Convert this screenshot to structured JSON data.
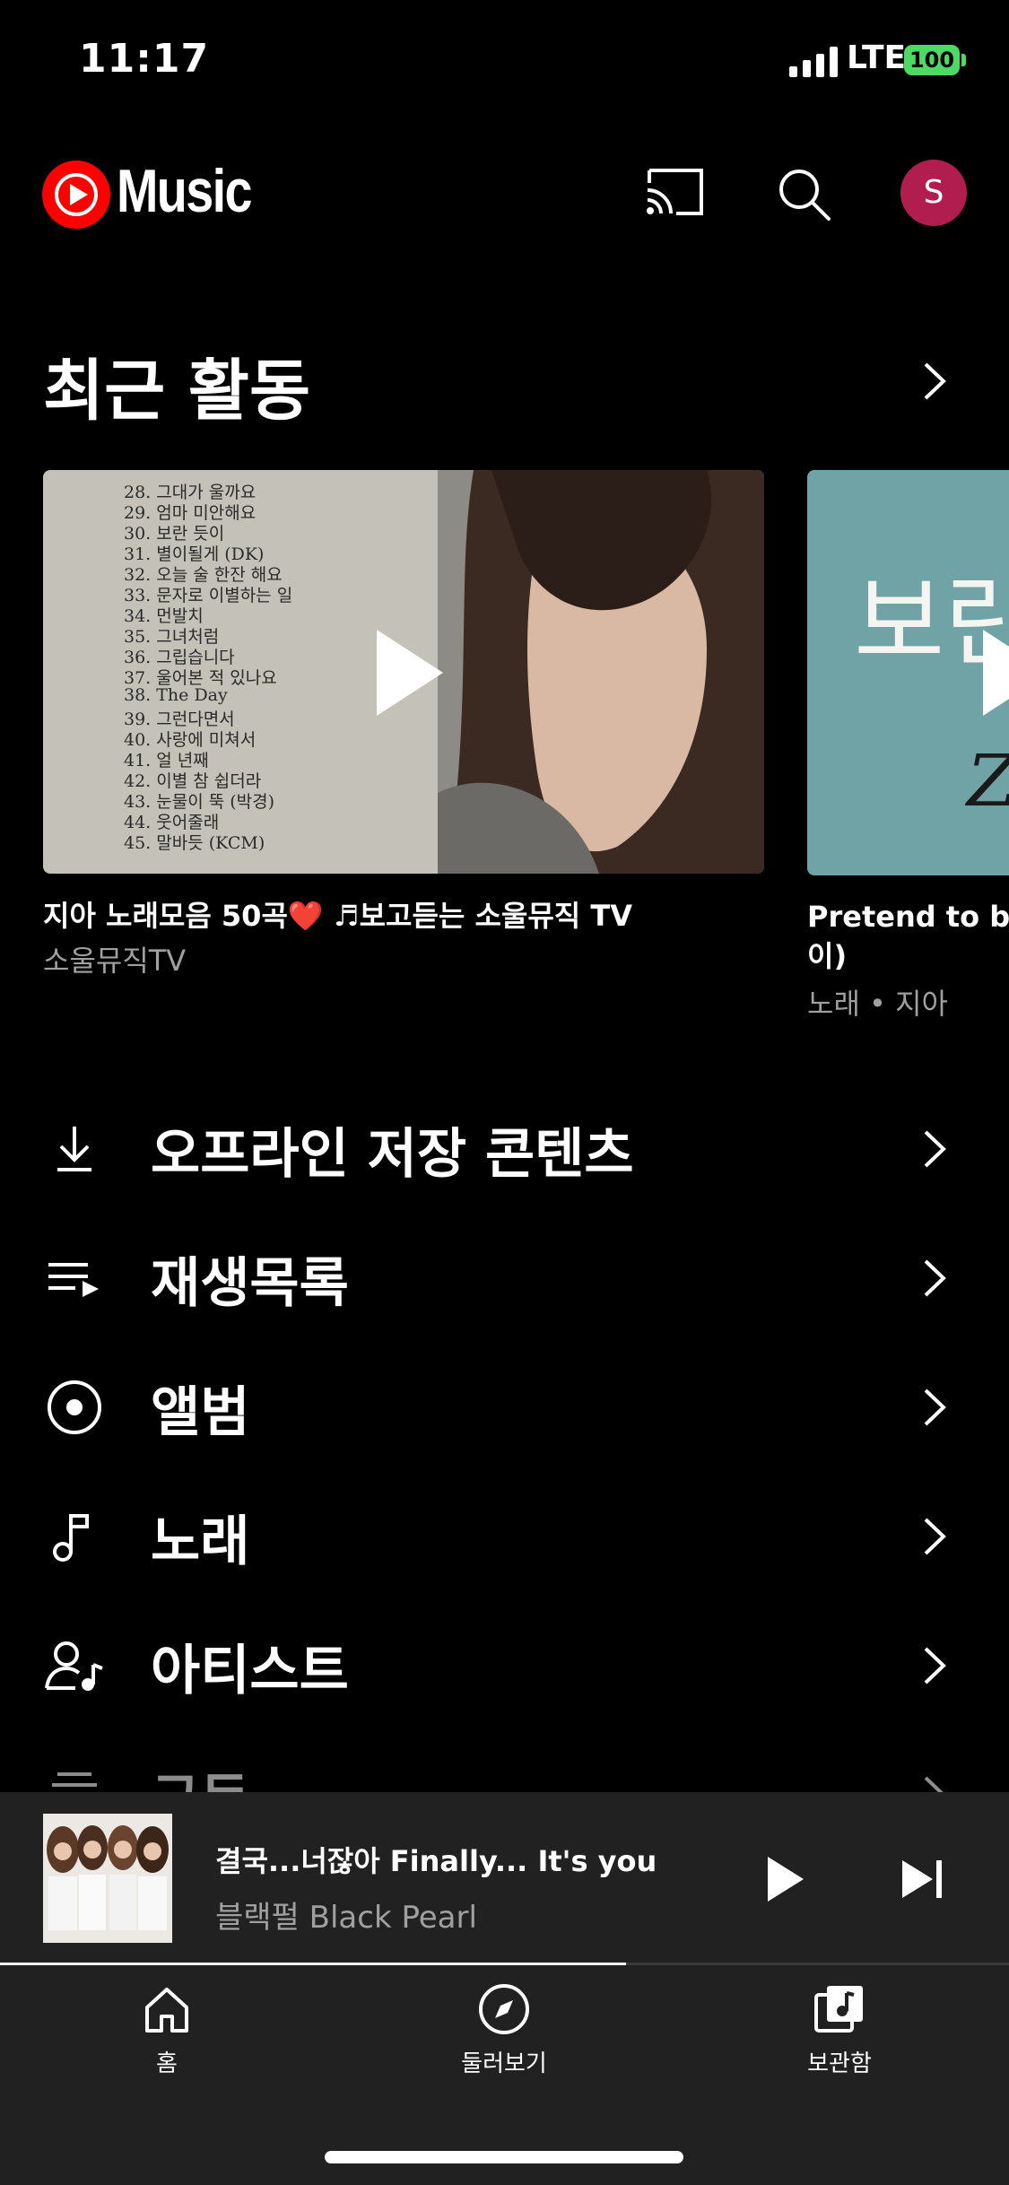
{
  "status_bar": {
    "time": "11:17",
    "network": "LTE",
    "battery": "100"
  },
  "header": {
    "app_name": "Music",
    "avatar_initial": "S"
  },
  "recent": {
    "title": "최근 활동",
    "cards": [
      {
        "title": "지아 노래모음 50곡❤️ ♬보고듣는 소울뮤직 TV",
        "subtitle": "소울뮤직TV",
        "thumb_lines": [
          "28. 그대가 울까요",
          "29. 엄마 미안해요",
          "30. 보란 듯이",
          "31. 별이될게 (DK)",
          "32. 오늘 술 한잔 해요",
          "33. 문자로 이별하는 일",
          "34. 먼발치",
          "35. 그녀처럼",
          "36. 그립습니다",
          "37. 울어본 적 있나요",
          "38. The Day",
          "39. 그런다면서",
          "40. 사랑에 미쳐서",
          "41. 얼 년째",
          "42. 이별 참 쉽더라",
          "43. 눈물이 뚝 (박경)",
          "44. 웃어줄래",
          "45. 말바듯 (KCM)"
        ]
      },
      {
        "title_line1": "Pretend to be",
        "title_line2": "이)",
        "subtitle": "노래 • 지아",
        "thumb_text": "보란",
        "thumb_letter": "Z"
      }
    ]
  },
  "library": {
    "items": [
      {
        "label": "오프라인 저장 콘텐츠",
        "icon": "download-icon"
      },
      {
        "label": "재생목록",
        "icon": "playlist-icon"
      },
      {
        "label": "앨범",
        "icon": "album-icon"
      },
      {
        "label": "노래",
        "icon": "music-note-icon"
      },
      {
        "label": "아티스트",
        "icon": "artist-icon"
      },
      {
        "label": "구독",
        "icon": "subscriptions-icon"
      }
    ]
  },
  "mini_player": {
    "title": "결국...너잖아 Finally... It's you",
    "artist": "블랙펄 Black Pearl",
    "progress_fraction": 0.62
  },
  "bottom_nav": {
    "items": [
      {
        "label": "홈",
        "icon": "home-icon"
      },
      {
        "label": "둘러보기",
        "icon": "explore-icon"
      },
      {
        "label": "보관함",
        "icon": "library-icon"
      }
    ]
  },
  "colors": {
    "brand_red": "#ff0000",
    "avatar_bg": "#b11d4f",
    "battery": "#4cd964"
  }
}
